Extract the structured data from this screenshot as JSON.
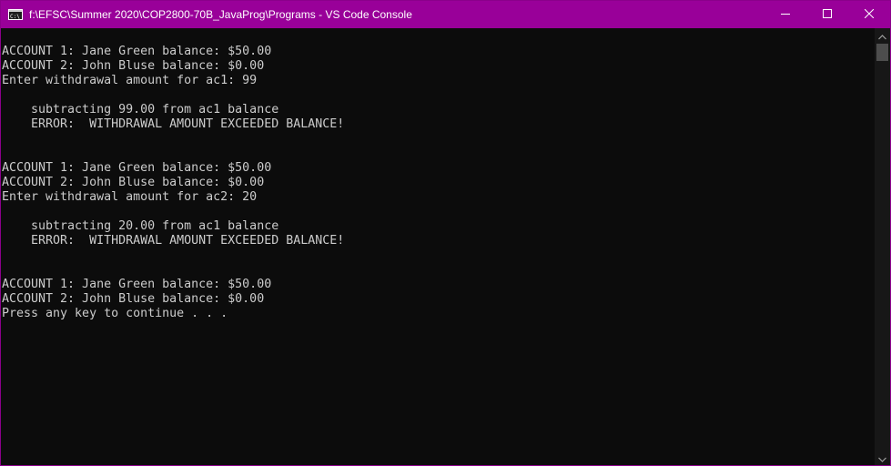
{
  "window": {
    "title": "f:\\EFSC\\Summer 2020\\COP2800-70B_JavaProg\\Programs - VS Code Console",
    "icon": "cmd-console-icon",
    "controls": [
      "minimize-icon",
      "maximize-icon",
      "close-icon"
    ]
  },
  "colors": {
    "titlebar": "#990099",
    "console_background": "#0c0c0c",
    "console_text": "#cccccc"
  },
  "console": {
    "lines": [
      "",
      "ACCOUNT 1: Jane Green balance: $50.00",
      "ACCOUNT 2: John Bluse balance: $0.00",
      "Enter withdrawal amount for ac1: 99",
      "",
      "    subtracting 99.00 from ac1 balance",
      "    ERROR:  WITHDRAWAL AMOUNT EXCEEDED BALANCE!",
      "",
      "",
      "ACCOUNT 1: Jane Green balance: $50.00",
      "ACCOUNT 2: John Bluse balance: $0.00",
      "Enter withdrawal amount for ac2: 20",
      "",
      "    subtracting 20.00 from ac1 balance",
      "    ERROR:  WITHDRAWAL AMOUNT EXCEEDED BALANCE!",
      "",
      "",
      "ACCOUNT 1: Jane Green balance: $50.00",
      "ACCOUNT 2: John Bluse balance: $0.00",
      "Press any key to continue . . ."
    ]
  }
}
